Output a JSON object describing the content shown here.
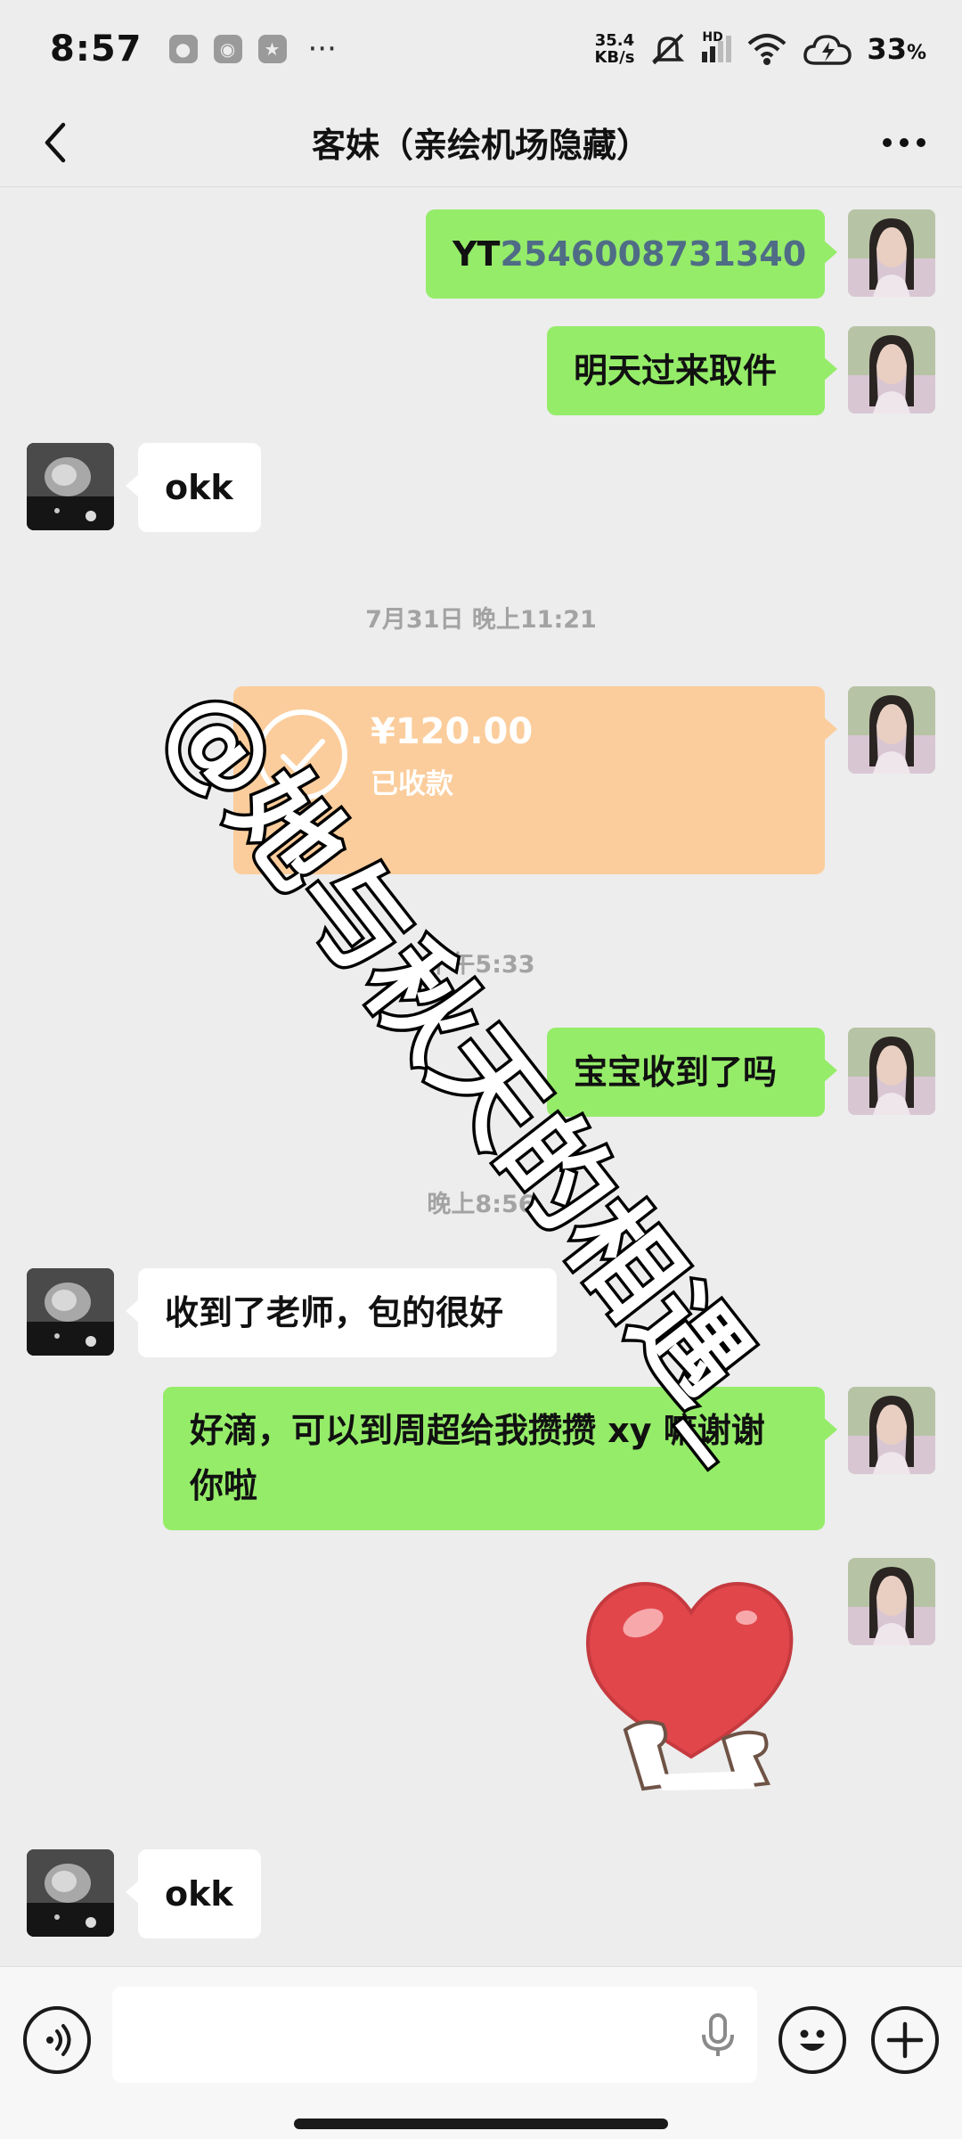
{
  "status_bar": {
    "time": "8:57",
    "net_speed_value": "35.4",
    "net_speed_unit": "KB/s",
    "network_label": "HD",
    "battery_percent": "33",
    "battery_unit": "%"
  },
  "nav": {
    "title": "客妹（亲绘机场隐藏）"
  },
  "messages": [
    {
      "side": "me",
      "type": "text",
      "prefix": "YT",
      "tracking_number": "2546008731340"
    },
    {
      "side": "me",
      "type": "text",
      "text": "明天过来取件"
    },
    {
      "side": "other",
      "type": "text",
      "text": "okk"
    },
    {
      "type": "timestamp",
      "text": "7月31日 晚上11:21"
    },
    {
      "side": "me",
      "type": "transfer",
      "amount": "¥120.00",
      "status": "已收款"
    },
    {
      "type": "timestamp",
      "text": "下午5:33"
    },
    {
      "side": "me",
      "type": "text",
      "text": "宝宝收到了吗"
    },
    {
      "type": "timestamp",
      "text": "晚上8:56"
    },
    {
      "side": "other",
      "type": "text",
      "text": "收到了老师，包的很好"
    },
    {
      "side": "me",
      "type": "text",
      "line1": "好滴，可以到周超给我攒攒 xy 嘛谢谢",
      "line2": "你啦"
    },
    {
      "side": "me",
      "type": "sticker",
      "sticker": "heart-hands-sticker"
    },
    {
      "side": "other",
      "type": "text",
      "text": "okk"
    }
  ],
  "watermark": "@她与秋天的相遇_",
  "input_bar": {
    "placeholder": "",
    "icons": [
      "voice-icon",
      "microphone-icon",
      "emoji-icon",
      "plus-icon"
    ]
  },
  "colors": {
    "background": "#ededed",
    "my_bubble": "#95ec69",
    "their_bubble": "#ffffff",
    "transfer_card": "#fbcd9c",
    "tracking_link": "#4f6c86",
    "timestamp": "#a3a3a3"
  }
}
